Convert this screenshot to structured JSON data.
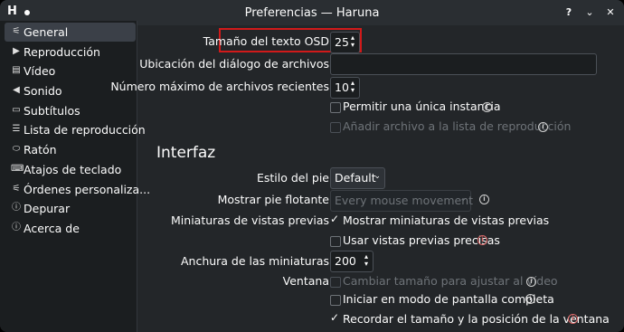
{
  "window": {
    "title": "Preferencias — Haruna",
    "logo": "H",
    "help_label": "?",
    "minimize_label": "⌄",
    "close_label": "✕"
  },
  "sidebar": {
    "items": [
      {
        "label": "General",
        "icon": "sliders-icon",
        "glyph": "⚟"
      },
      {
        "label": "Reproducción",
        "icon": "play-icon",
        "glyph": "▶"
      },
      {
        "label": "Vídeo",
        "icon": "film-icon",
        "glyph": "▤"
      },
      {
        "label": "Sonido",
        "icon": "speaker-icon",
        "glyph": "◀"
      },
      {
        "label": "Subtítulos",
        "icon": "subtitles-icon",
        "glyph": "▭"
      },
      {
        "label": "Lista de reproducción",
        "icon": "playlist-icon",
        "glyph": "☰"
      },
      {
        "label": "Ratón",
        "icon": "mouse-icon",
        "glyph": "⬭"
      },
      {
        "label": "Atajos de teclado",
        "icon": "keyboard-icon",
        "glyph": "⌨"
      },
      {
        "label": "Órdenes personaliza...",
        "icon": "command-icon",
        "glyph": "⚟"
      },
      {
        "label": "Depurar",
        "icon": "info-icon",
        "glyph": "ⓘ"
      },
      {
        "label": "Acerca de",
        "icon": "info-icon",
        "glyph": "ⓘ"
      }
    ]
  },
  "general": {
    "osd_label": "Tamaño del texto OSD",
    "osd_value": "25",
    "file_dialog_label": "Ubicación del diálogo de archivos",
    "file_dialog_value": "",
    "max_recent_label": "Número máximo de archivos recientes",
    "max_recent_value": "10",
    "single_instance_label": "Permitir una única instancia",
    "add_to_playlist_label": "Añadir archivo a la lista de reproducción"
  },
  "interface": {
    "heading": "Interfaz",
    "footer_style_label": "Estilo del pie",
    "footer_style_value": "Default",
    "floating_footer_label": "Mostrar pie flotante",
    "floating_footer_value": "Every mouse movement",
    "thumbnails_label": "Miniaturas de vistas previas",
    "show_thumbnails_label": "Mostrar miniaturas de vistas previas",
    "accurate_previews_label": "Usar vistas previas precisas",
    "thumb_width_label": "Anchura de las miniaturas",
    "thumb_width_value": "200",
    "window_label": "Ventana",
    "resize_to_video_label": "Cambiar tamaño para ajustar al vídeo",
    "start_fullscreen_label": "Iniciar en modo de pantalla completa",
    "remember_size_label": "Recordar el tamaño y la posición de la ventana"
  },
  "colors": {
    "background": "#232629",
    "sidebar": "#1b1e20",
    "highlight": "#d11a1a",
    "warning": "#e06c6c"
  }
}
